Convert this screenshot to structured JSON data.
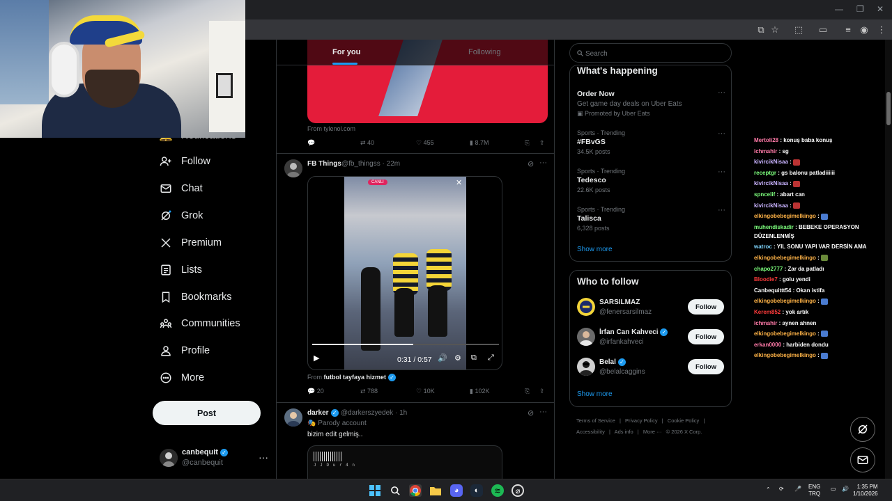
{
  "feed_tabs": {
    "for_you": "For you",
    "following": "Following"
  },
  "nav": {
    "notifications_partial": "Notifications",
    "follow": "Follow",
    "chat": "Chat",
    "grok": "Grok",
    "premium": "Premium",
    "lists": "Lists",
    "bookmarks": "Bookmarks",
    "communities": "Communities",
    "profile": "Profile",
    "more": "More",
    "post": "Post"
  },
  "account": {
    "name": "canbequit",
    "handle": "@canbequit"
  },
  "ad_post": {
    "from": "From tylenol.com",
    "replies": "",
    "reposts": "40",
    "likes": "455",
    "views": "8.7M"
  },
  "post1": {
    "name": "FB Things",
    "handle": "@fb_thingss",
    "time": "· 22m",
    "video_time": "0:31 / 0:57",
    "video_progress": 0.54,
    "live_badge": "CANLI",
    "from_prefix": "From",
    "from_source": "futbol tayfaya hizmet",
    "replies": "20",
    "reposts": "788",
    "likes": "10K",
    "views": "102K"
  },
  "post2": {
    "name": "darker",
    "handle": "@darkerszyedek",
    "time": "· 1h",
    "label": "Parody account",
    "text": "bizim edit gelmiş..",
    "barcode_text": "J J D u r 4 n"
  },
  "search": {
    "placeholder": "Search"
  },
  "whats_happening": {
    "title": "What's happening",
    "promo": {
      "title": "Order Now",
      "desc": "Get game day deals on Uber Eats",
      "promoted": "Promoted by Uber Eats"
    },
    "trends": [
      {
        "context": "Sports · Trending",
        "title": "#FBvGS",
        "count": "34.5K posts"
      },
      {
        "context": "Sports · Trending",
        "title": "Tedesco",
        "count": "22.6K posts"
      },
      {
        "context": "Sports · Trending",
        "title": "Talisca",
        "count": "6,328 posts"
      }
    ],
    "show_more": "Show more"
  },
  "who_to_follow": {
    "title": "Who to follow",
    "users": [
      {
        "name": "SARSILMAZ",
        "handle": "@fenersarsilmaz",
        "button": "Follow"
      },
      {
        "name": "İrfan Can Kahveci",
        "handle": "@irfankahveci",
        "button": "Follow"
      },
      {
        "name": "Belal",
        "handle": "@belalcaggins",
        "button": "Follow"
      }
    ],
    "show_more": "Show more"
  },
  "footer": {
    "links": [
      "Terms of Service",
      "|",
      "Privacy Policy",
      "|",
      "Cookie Policy",
      "|",
      "Accessibility",
      "|",
      "Ads info",
      "|",
      "More ···",
      "© 2026 X Corp."
    ]
  },
  "chat": [
    {
      "user": "Mertoli28",
      "color": "#ff7aa8",
      "msg": ": konuş baba konuş"
    },
    {
      "user": "ichmahir",
      "color": "#ff7aa8",
      "msg": ": sg"
    },
    {
      "user": "kivircikNisaa",
      "color": "#c9b3ff",
      "msg": ":",
      "emote": "#b33"
    },
    {
      "user": "receptgr",
      "color": "#7dff7d",
      "msg": ": gs balonu patladiiiiii"
    },
    {
      "user": "kivircikNisaa",
      "color": "#c9b3ff",
      "msg": ":",
      "emote": "#b33"
    },
    {
      "user": "spncelif",
      "color": "#7dff7d",
      "msg": ": abart can"
    },
    {
      "user": "kivircikNisaa",
      "color": "#c9b3ff",
      "msg": ":",
      "emote": "#b33"
    },
    {
      "user": "elkingobebegimelkingo",
      "color": "#ffb347",
      "msg": ":",
      "emote": "#4a7bd0"
    },
    {
      "user": "muhendiskadir",
      "color": "#7dff7d",
      "msg": ": BEBEKE OPERASYON DÜZENLENMİŞ"
    },
    {
      "user": "watroc",
      "color": "#7fd6ff",
      "msg": ": YIL SONU YAPI VAR DERSİN AMA"
    },
    {
      "user": "elkingobebegimelkingo",
      "color": "#ffb347",
      "msg": ":",
      "emote": "#6a8a3a"
    },
    {
      "user": "chapo2777",
      "color": "#7dff7d",
      "msg": ": Zar da patladı"
    },
    {
      "user": "Bloodie7",
      "color": "#ff3b3b",
      "msg": ": golu yendi"
    },
    {
      "user": "Canbequittt54",
      "color": "#ffffff",
      "msg": ": Okan istifa"
    },
    {
      "user": "elkingobebegimelkingo",
      "color": "#ffb347",
      "msg": ":",
      "emote": "#4a7bd0"
    },
    {
      "user": "Kerem852",
      "color": "#ff3b3b",
      "msg": ": yok artık"
    },
    {
      "user": "ichmahir",
      "color": "#ff7aa8",
      "msg": ": aynen ahnen"
    },
    {
      "user": "elkingobebegimelkingo",
      "color": "#ffb347",
      "msg": ":",
      "emote": "#4a7bd0"
    },
    {
      "user": "erkan0000",
      "color": "#ff7aa8",
      "msg": ": harbiden dondu"
    },
    {
      "user": "elkingobebegimelkingo",
      "color": "#ffb347",
      "msg": ":",
      "emote": "#4a7bd0"
    }
  ],
  "taskbar": {
    "lang_1": "ENG",
    "lang_2": "TRQ",
    "time": "1:35 PM",
    "date": "1/10/2026"
  },
  "colors": {
    "accent": "#1d9bf0",
    "ad_red": "#e41c3a"
  }
}
